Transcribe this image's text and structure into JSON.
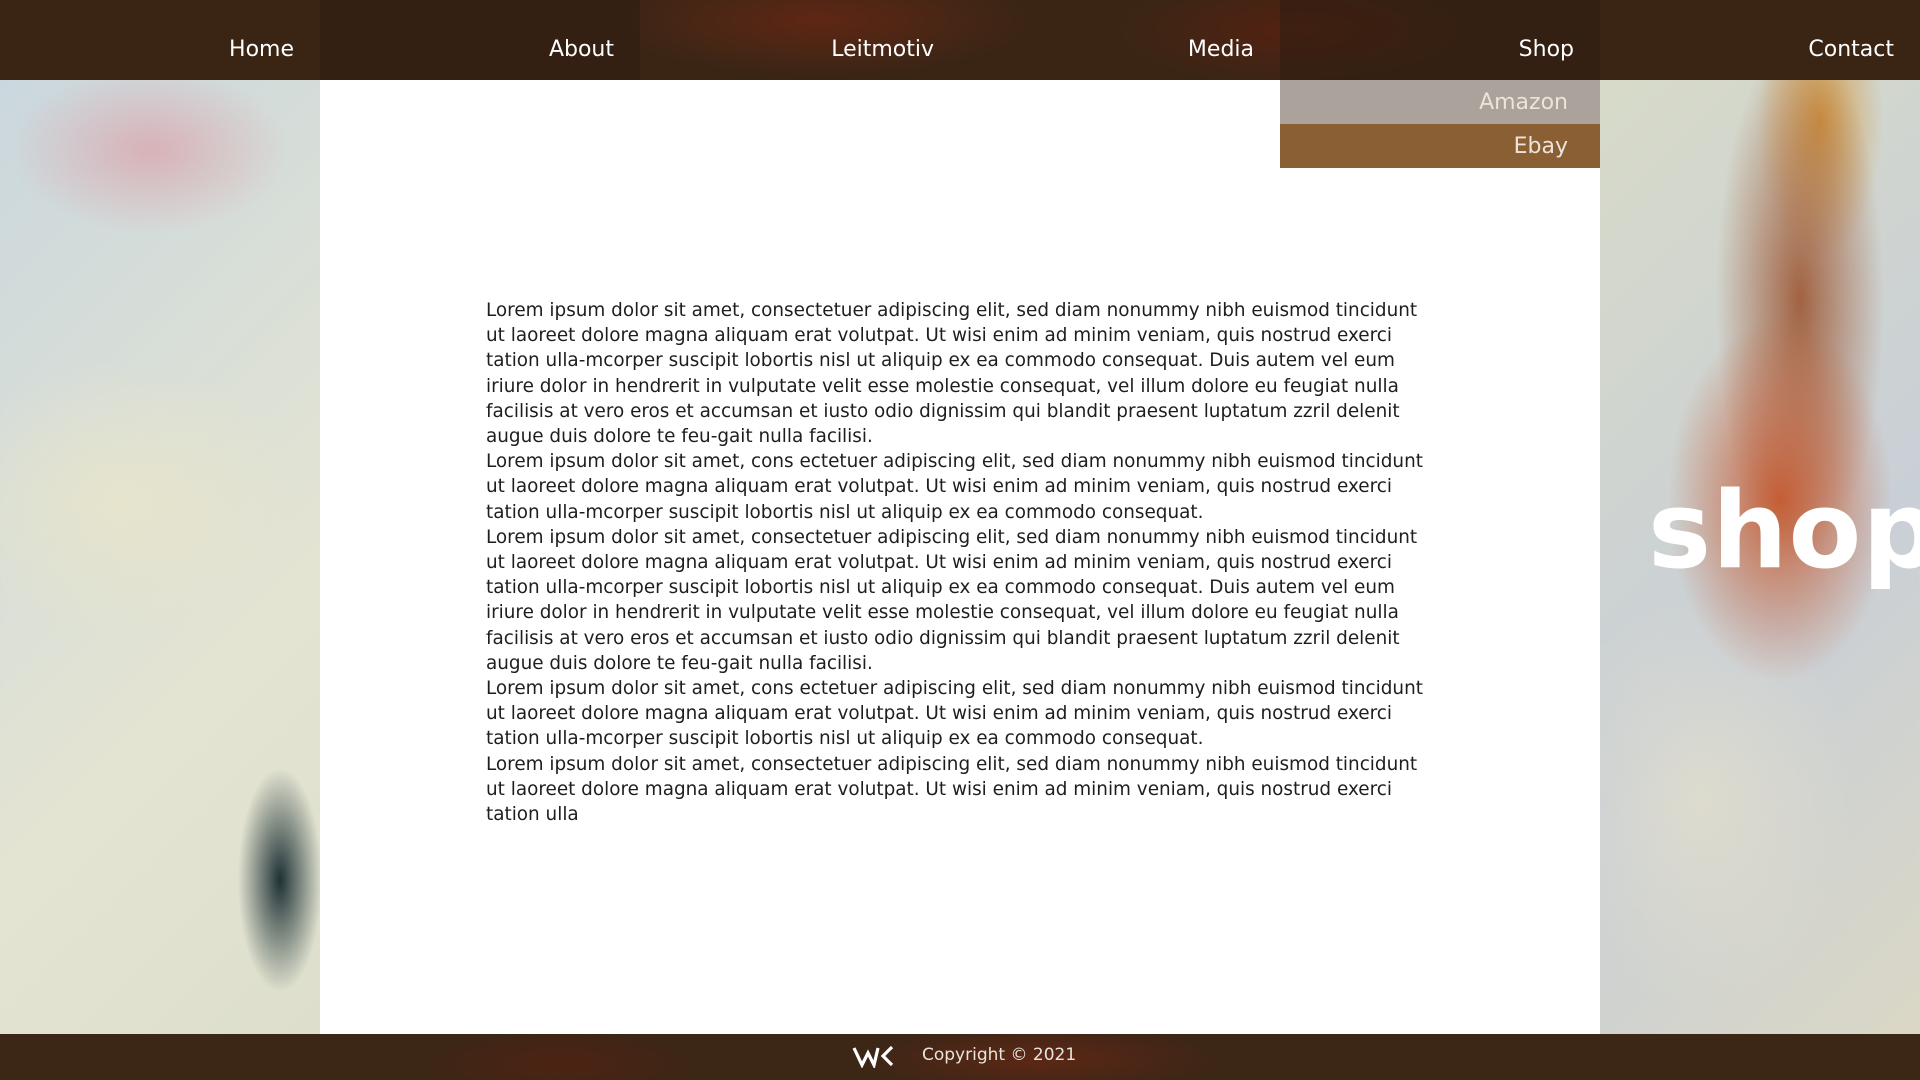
{
  "nav": {
    "items": [
      {
        "label": "Home"
      },
      {
        "label": "About"
      },
      {
        "label": "Leitmotiv"
      },
      {
        "label": "Media"
      },
      {
        "label": "Shop"
      },
      {
        "label": "Contact"
      }
    ],
    "shop_dropdown": [
      {
        "label": "Amazon"
      },
      {
        "label": "Ebay"
      }
    ]
  },
  "page_heading": "shop",
  "content": {
    "paragraphs": [
      "Lorem ipsum dolor sit amet, consectetuer adipiscing elit, sed diam nonummy nibh euismod tincidunt ut laoreet dolore magna aliquam erat volutpat. Ut wisi enim ad minim veniam, quis nostrud exerci tation ulla-mcorper suscipit lobortis nisl ut aliquip ex ea commodo consequat. Duis autem vel eum iriure dolor in hendrerit in vulputate velit esse molestie consequat, vel illum dolore eu feugiat nulla facilisis at vero eros et accumsan et iusto odio dignissim qui blandit praesent luptatum zzril delenit augue duis dolore te feu-gait nulla facilisi.",
      "Lorem ipsum dolor sit amet, cons ectetuer adipiscing elit, sed diam nonummy nibh euismod tincidunt ut laoreet dolore magna aliquam erat volutpat. Ut wisi enim ad minim veniam, quis nostrud exerci tation ulla-mcorper suscipit lobortis nisl ut aliquip ex ea commodo consequat.",
      "Lorem ipsum dolor sit amet, consectetuer adipiscing elit, sed diam nonummy nibh euismod tincidunt ut laoreet dolore magna aliquam erat volutpat. Ut wisi enim ad minim veniam, quis nostrud exerci tation ulla-mcorper suscipit lobortis nisl ut aliquip ex ea commodo consequat. Duis autem vel eum iriure dolor in hendrerit in vulputate velit esse molestie consequat, vel illum dolore eu feugiat nulla facilisis at vero eros et accumsan et iusto odio dignissim qui blandit praesent luptatum zzril delenit augue duis dolore te feu-gait nulla facilisi.",
      "Lorem ipsum dolor sit amet, cons ectetuer adipiscing elit, sed diam nonummy nibh euismod tincidunt ut laoreet dolore magna aliquam erat volutpat. Ut wisi enim ad minim veniam, quis nostrud exerci tation ulla-mcorper suscipit lobortis nisl ut aliquip ex ea commodo consequat.",
      "Lorem ipsum dolor sit amet, consectetuer adipiscing elit, sed diam nonummy nibh euismod tincidunt ut laoreet dolore magna aliquam erat volutpat. Ut wisi enim ad minim veniam, quis nostrud exerci tation ulla"
    ]
  },
  "footer": {
    "logo_text": "WK",
    "logo_icon": "wk-monogram-icon",
    "copyright": "Copyright © 2021"
  },
  "colors": {
    "nav_background": "#3a2515",
    "dropdown_amazon": "#aba29c",
    "dropdown_ebay": "#8a5f34",
    "content_background": "#ffffff",
    "text": "#1e1e1e"
  }
}
